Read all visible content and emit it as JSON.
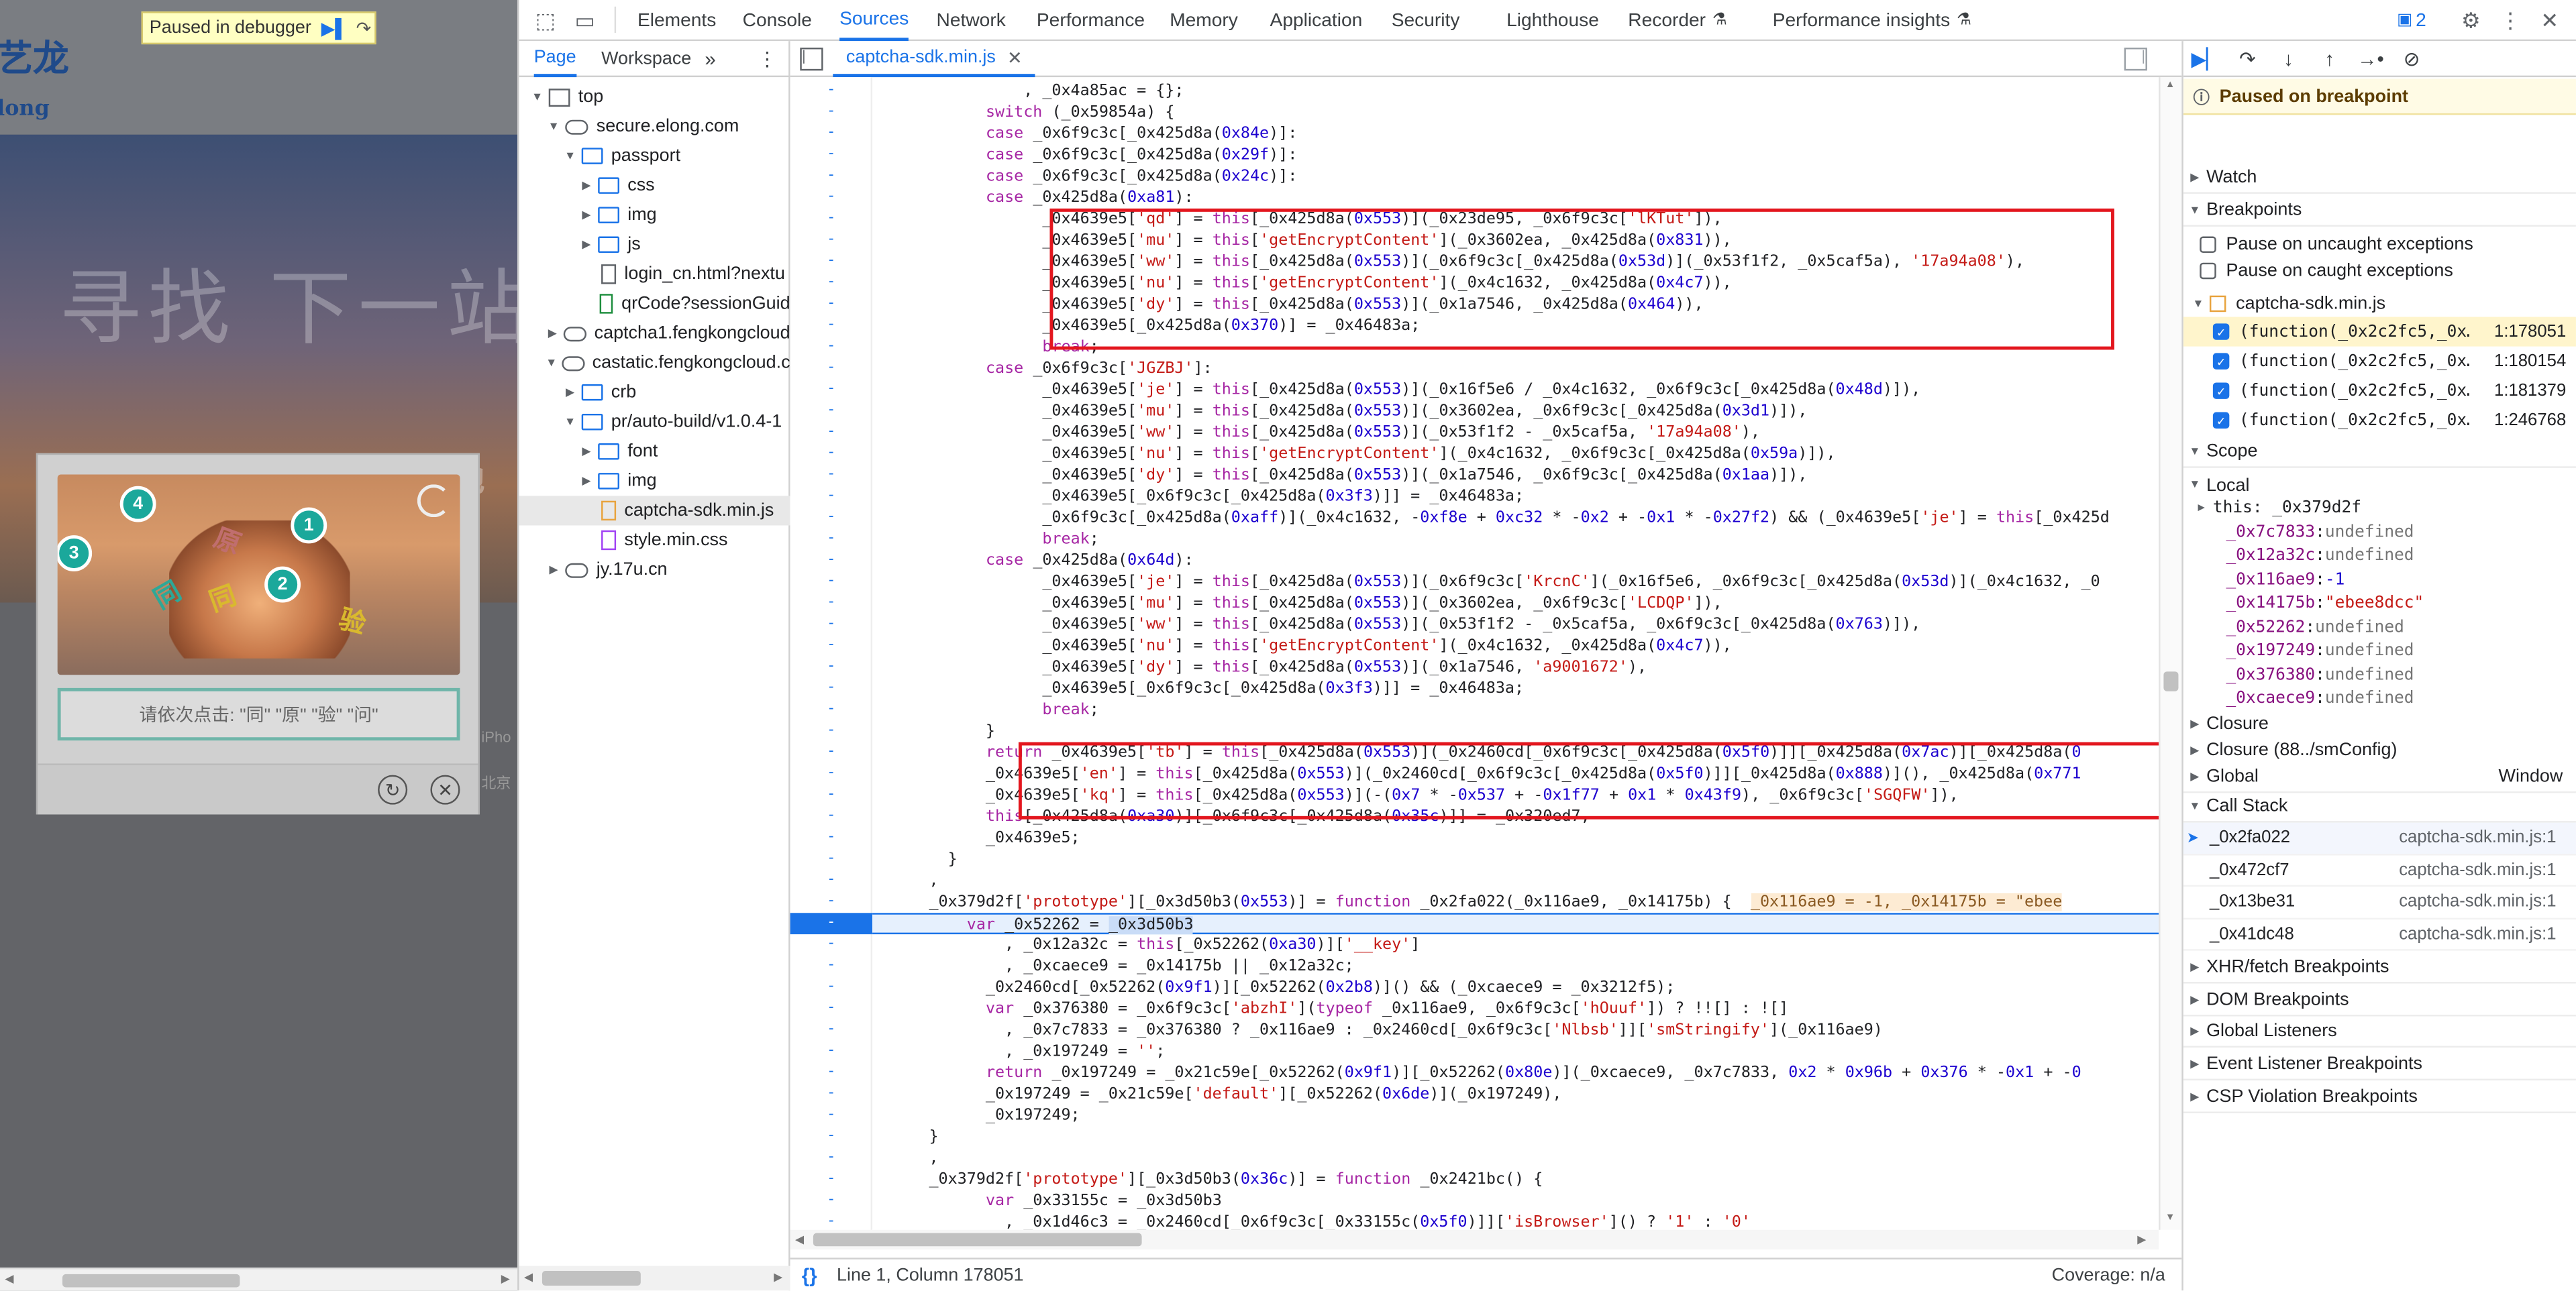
{
  "page": {
    "logo_text": "艺龙",
    "logo_sub": "long",
    "hero_text": "寻找 下一站",
    "hero_sub": "的地",
    "paused_label": "Paused in debugger",
    "side_text_1": "iPho",
    "side_text_2": "北京",
    "captcha": {
      "dots": [
        {
          "n": "4"
        },
        {
          "n": "1"
        },
        {
          "n": "3"
        },
        {
          "n": "2"
        }
      ],
      "chars": [
        "同",
        "原",
        "验",
        "同"
      ],
      "prompt": "请依次点击: \"同\" \"原\" \"验\" \"问\""
    }
  },
  "devtools": {
    "tabs": [
      "Elements",
      "Console",
      "Sources",
      "Network",
      "Performance",
      "Memory",
      "Application",
      "Security",
      "Lighthouse",
      "Recorder",
      "Performance insights"
    ],
    "active_tab": "Sources",
    "issues_badge": "2",
    "navigator": {
      "tabs": [
        "Page",
        "Workspace"
      ],
      "tree": [
        {
          "label": "top",
          "kind": "frame",
          "depth": 0,
          "open": true
        },
        {
          "label": "secure.elong.com",
          "kind": "cloud",
          "depth": 1,
          "open": true
        },
        {
          "label": "passport",
          "kind": "folder",
          "depth": 2,
          "open": true
        },
        {
          "label": "css",
          "kind": "folder",
          "depth": 3,
          "open": false
        },
        {
          "label": "img",
          "kind": "folder",
          "depth": 3,
          "open": false
        },
        {
          "label": "js",
          "kind": "folder",
          "depth": 3,
          "open": false
        },
        {
          "label": "login_cn.html?nextu",
          "kind": "file",
          "depth": 3
        },
        {
          "label": "qrCode?sessionGuid",
          "kind": "file-green",
          "depth": 3
        },
        {
          "label": "captcha1.fengkongcloud",
          "kind": "cloud",
          "depth": 1,
          "open": false
        },
        {
          "label": "castatic.fengkongcloud.c",
          "kind": "cloud",
          "depth": 1,
          "open": true
        },
        {
          "label": "crb",
          "kind": "folder",
          "depth": 2,
          "open": false
        },
        {
          "label": "pr/auto-build/v1.0.4-1",
          "kind": "folder",
          "depth": 2,
          "open": true
        },
        {
          "label": "font",
          "kind": "folder",
          "depth": 3,
          "open": false
        },
        {
          "label": "img",
          "kind": "folder",
          "depth": 3,
          "open": false
        },
        {
          "label": "captcha-sdk.min.js",
          "kind": "file-js",
          "depth": 3,
          "selected": true
        },
        {
          "label": "style.min.css",
          "kind": "file-css",
          "depth": 3
        },
        {
          "label": "jy.17u.cn",
          "kind": "cloud",
          "depth": 1,
          "open": false
        }
      ]
    },
    "editor": {
      "file_tab": "captcha-sdk.min.js",
      "status_position": "Line 1, Column 178051",
      "coverage": "Coverage: n/a"
    },
    "right": {
      "paused_on": "Paused on breakpoint",
      "watch": "Watch",
      "breakpoints": "Breakpoints",
      "pause_uncaught": "Pause on uncaught exceptions",
      "pause_caught": "Pause on caught exceptions",
      "bp_file": "captcha-sdk.min.js",
      "bp_items": [
        {
          "code": "(function(_0x2c2fc5,_0x…",
          "loc": "1:178051"
        },
        {
          "code": "(function(_0x2c2fc5,_0x…",
          "loc": "1:180154"
        },
        {
          "code": "(function(_0x2c2fc5,_0x…",
          "loc": "1:181379"
        },
        {
          "code": "(function(_0x2c2fc5,_0x…",
          "loc": "1:246768"
        }
      ],
      "scope": "Scope",
      "local": "Local",
      "this_row": "this: _0x379d2f",
      "scope_vars": [
        {
          "k": "_0x7c7833",
          "v": "undefined"
        },
        {
          "k": "_0x12a32c",
          "v": "undefined"
        },
        {
          "k": "_0x116ae9",
          "v": "-1"
        },
        {
          "k": "_0x14175b",
          "v": "\"ebee8dcc\""
        },
        {
          "k": "_0x52262",
          "v": "undefined"
        },
        {
          "k": "_0x197249",
          "v": "undefined"
        },
        {
          "k": "_0x376380",
          "v": "undefined"
        },
        {
          "k": "_0xcaece9",
          "v": "undefined"
        }
      ],
      "closure": "Closure",
      "closure2": "Closure (88../smConfig)",
      "global": "Global",
      "global_val": "Window",
      "call_stack": "Call Stack",
      "frames": [
        {
          "fn": "_0x2fa022",
          "loc": "captcha-sdk.min.js:1"
        },
        {
          "fn": "_0x472cf7",
          "loc": "captcha-sdk.min.js:1"
        },
        {
          "fn": "_0x13be31",
          "loc": "captcha-sdk.min.js:1"
        },
        {
          "fn": "_0x41dc48",
          "loc": "captcha-sdk.min.js:1"
        }
      ],
      "more_sections": [
        "XHR/fetch Breakpoints",
        "DOM Breakpoints",
        "Global Listeners",
        "Event Listener Breakpoints",
        "CSP Violation Breakpoints"
      ]
    }
  }
}
